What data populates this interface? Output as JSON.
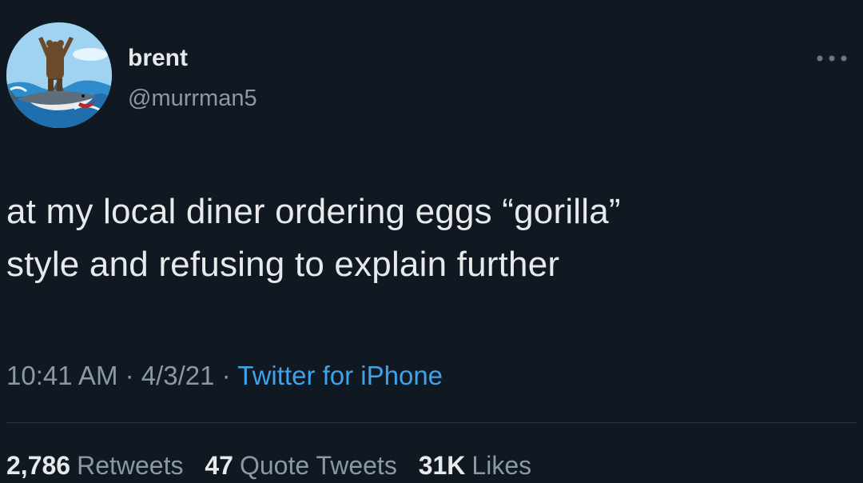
{
  "author": {
    "display_name": "brent",
    "handle": "@murrman5",
    "avatar_icon": "avatar-bear-surfing-shark"
  },
  "more_icon": "more-options-icon",
  "tweet": {
    "line1": "at my local diner ordering eggs “gorilla”",
    "line2": "style and refusing to explain further"
  },
  "meta": {
    "time": "10:41 AM",
    "sep1": " · ",
    "date": "4/3/21",
    "sep2": " · ",
    "source": "Twitter for iPhone"
  },
  "stats": {
    "retweets": {
      "count": "2,786",
      "label": "Retweets"
    },
    "quotes": {
      "count": "47",
      "label": "Quote Tweets"
    },
    "likes": {
      "count": "31K",
      "label": "Likes"
    }
  },
  "colors": {
    "background": "#101821",
    "text": "#e7e9ea",
    "secondary": "#8b98a5",
    "link": "#3fa3ea"
  }
}
